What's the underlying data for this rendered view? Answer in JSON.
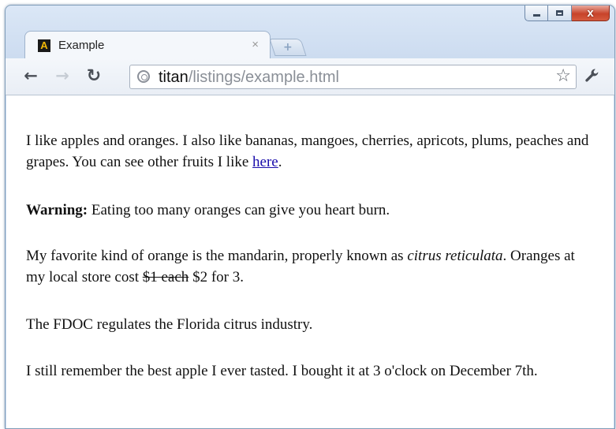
{
  "window": {
    "caption_buttons": [
      "minimize-icon",
      "maximize-icon",
      "close-icon"
    ]
  },
  "tab": {
    "title": "Example",
    "close_glyph": "×",
    "favicon_letter": "A",
    "new_tab_icon": "new-tab-icon"
  },
  "toolbar": {
    "back_icon": "back-arrow-icon",
    "forward_icon": "forward-arrow-icon",
    "reload_icon": "reload-icon",
    "wrench_icon": "wrench-icon",
    "star_icon": "star-icon",
    "url_host": "titan",
    "url_path": "/listings/example.html"
  },
  "content": {
    "p1": {
      "text": "I like apples and oranges. I also like bananas, mangoes, cherries, apricots, plums, peaches and grapes. You can see other fruits I like ",
      "link": "here",
      "end": "."
    },
    "p2": {
      "bold": "Warning:",
      "text": " Eating too many oranges can give you heart burn."
    },
    "p3": {
      "text": "My favorite kind of orange is the mandarin, properly known as ",
      "italic": "citrus reticulata",
      "mid": ". Oranges at my local store cost ",
      "struck": "$1 each",
      "end": " $2 for 3."
    },
    "p4": {
      "text": "The FDOC regulates the Florida citrus industry."
    },
    "p5": {
      "text": "I still remember the best apple I ever tasted. I bought it at 3 o'clock on December 7th."
    }
  },
  "colors": {
    "link": "#1a0dab",
    "close_button": "#c7432a",
    "frame": "#c7d8ee"
  }
}
